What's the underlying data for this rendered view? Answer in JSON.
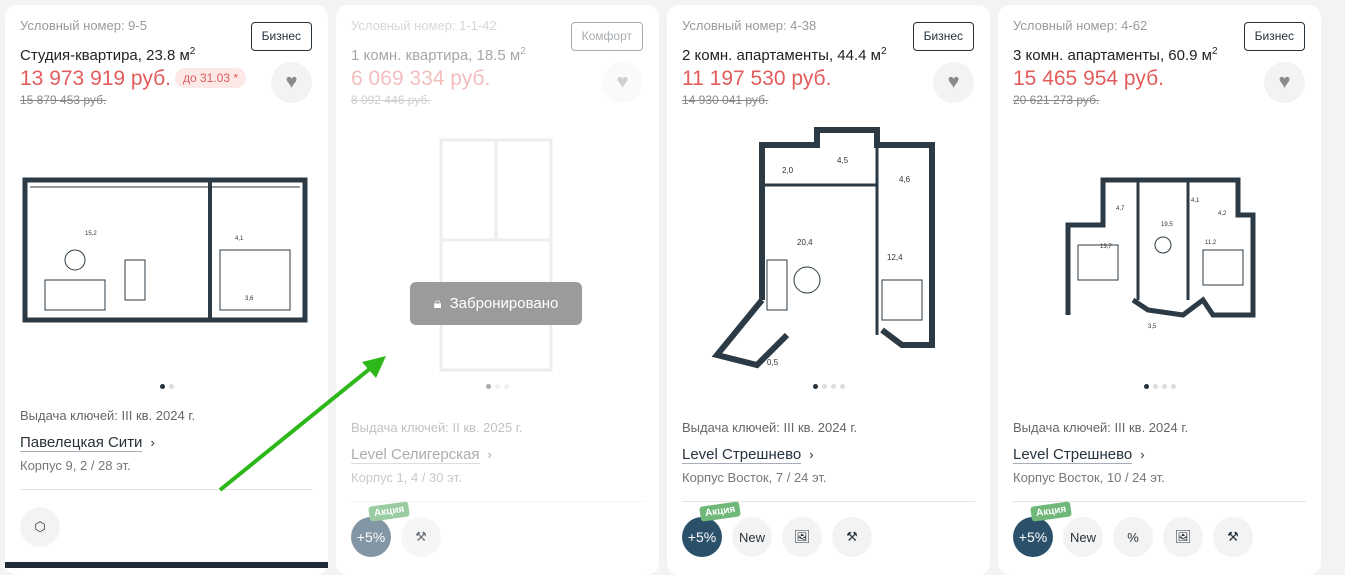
{
  "cards": [
    {
      "number": "Условный номер: 9-5",
      "class": "Бизнес",
      "title": "Студия-квартира, 23.8 м",
      "title_sup": "2",
      "price": "13 973 919 руб.",
      "until": "до 31.03 *",
      "old_price": "15 879 453 руб.",
      "keys": "Выдача ключей: III кв. 2024 г.",
      "project": "Павелецкая Сити",
      "building": "Корпус 9, 2 / 28 эт.",
      "dots": 2,
      "active_dot": 0,
      "icons": [
        "cube-icon"
      ]
    },
    {
      "number": "Условный номер: 1-1-42",
      "class": "Комфорт",
      "title": "1 комн. квартира, 18.5 м",
      "title_sup": "2",
      "price": "6 069 334 руб.",
      "old_price": "8 092 446 руб.",
      "keys": "Выдача ключей: II кв. 2025 г.",
      "project": "Level Селигерская",
      "building": "Корпус 1, 4 / 30 эт.",
      "status": "Забронировано",
      "promo": "+5%",
      "promo_tag": "Акция",
      "dots": 3,
      "active_dot": 0,
      "icons": [
        "renovation-icon"
      ]
    },
    {
      "number": "Условный номер: 4-38",
      "class": "Бизнес",
      "title": "2 комн. апартаменты, 44.4 м",
      "title_sup": "2",
      "price": "11 197 530 руб.",
      "old_price": "14 930 041 руб.",
      "keys": "Выдача ключей: III кв. 2024 г.",
      "project": "Level Стрешнево",
      "building": "Корпус Восток, 7 / 24 эт.",
      "promo": "+5%",
      "promo_tag": "Акция",
      "new_label": "New",
      "dots": 4,
      "active_dot": 0,
      "icons": [
        "image-icon",
        "renovation-icon"
      ]
    },
    {
      "number": "Условный номер: 4-62",
      "class": "Бизнес",
      "title": "3 комн. апартаменты, 60.9 м",
      "title_sup": "2",
      "price": "15 465 954 руб.",
      "old_price": "20 621 273 руб.",
      "keys": "Выдача ключей: III кв. 2024 г.",
      "project": "Level Стрешнево",
      "building": "Корпус Восток, 10 / 24 эт.",
      "promo": "+5%",
      "promo_tag": "Акция",
      "new_label": "New",
      "discount_icon": "percent-icon",
      "dots": 4,
      "active_dot": 0,
      "icons": [
        "image-icon",
        "renovation-icon"
      ]
    }
  ],
  "colors": {
    "price": "#e25c5c",
    "accent": "#26323b",
    "promo": "#2b5069",
    "promo_tag": "#6fb87a",
    "arrow": "#2db81a"
  }
}
